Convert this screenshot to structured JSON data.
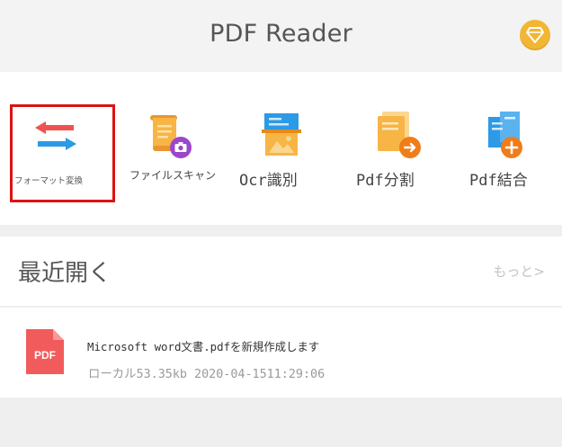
{
  "header": {
    "title": "PDF Reader",
    "premium_icon": "diamond-icon",
    "premium_color": "#f3b632"
  },
  "tools": [
    {
      "label": "フォーマット変換",
      "icon": "convert-arrows-icon",
      "selected": true
    },
    {
      "label": "ファイルスキャン",
      "icon": "scan-file-icon",
      "selected": false
    },
    {
      "label": "Ocr識別",
      "icon": "ocr-image-icon",
      "selected": false
    },
    {
      "label": "Pdf分割",
      "icon": "split-file-icon",
      "selected": false
    },
    {
      "label": "Pdf結合",
      "icon": "merge-file-icon",
      "selected": false
    }
  ],
  "recent": {
    "title": "最近開く",
    "more_label": "もっと>",
    "files": [
      {
        "name": "Microsoft word文書.pdfを新規作成します",
        "meta": "ローカル53.35kb 2020-04-1511:29:06",
        "icon_label": "PDF"
      }
    ]
  },
  "colors": {
    "selection_border": "#dd1212",
    "pdf_icon": "#f25b5b",
    "accent_blue": "#2c9ae6",
    "accent_orange": "#f7a935"
  }
}
